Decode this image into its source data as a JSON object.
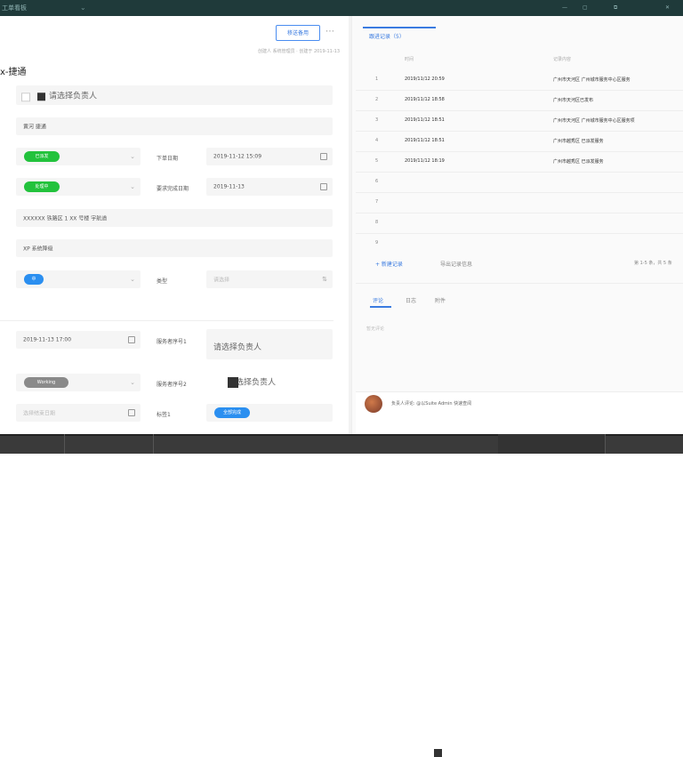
{
  "window": {
    "title": "工单看板"
  },
  "header": {
    "action_button": "移送备用",
    "meta": "创建人 系统管理员 · 创建于 2019-11-13",
    "page_title": "x-捷通"
  },
  "form": {
    "name_placeholder": "请选择负责人",
    "customer_value": "黄河 捷通",
    "status1_tag": "已派发",
    "status2_tag": "处理中",
    "order_date_label": "下单日期",
    "order_date_value": "2019-11-12 15:09",
    "deadline_label": "要求完成日期",
    "deadline_value": "2019-11-13",
    "address": "XXXXXX 铁路区 1 XX 号楼 宇航道",
    "remark": "XP 系统降级",
    "priority_tag": "中",
    "type_label": "类型",
    "type_placeholder": "请选择",
    "time2_value": "2019-11-13 17:00",
    "service_label": "服务者序号1",
    "service_placeholder": "请选择负责人",
    "status3_tag": "Working",
    "service2_label": "服务者序号2",
    "service2_value": "请选择负责人",
    "date3_placeholder": "选择结束日期",
    "level_label": "标签1",
    "level_tag": "全部完成"
  },
  "records": {
    "tab_label": "跟进记录（5）",
    "col_time": "时间",
    "col_content": "记录内容",
    "rows": [
      {
        "n": "1",
        "time": "2019/11/12 20:59",
        "content": "广州市天河区 广州城市服务中心区服务"
      },
      {
        "n": "2",
        "time": "2019/11/12 18:58",
        "content": "广州市天河区已发布"
      },
      {
        "n": "3",
        "time": "2019/11/12 18:51",
        "content": "广州市天河区 广州城市服务中心区服务项"
      },
      {
        "n": "4",
        "time": "2019/11/12 18:51",
        "content": "广州市越秀区 已派发服务"
      },
      {
        "n": "5",
        "time": "2019/11/12 18:19",
        "content": "广州市越秀区 已派发服务"
      }
    ],
    "empty_rows": [
      "6",
      "7",
      "8",
      "9"
    ],
    "add_link": "+ 新建记录",
    "export_link": "导出记录信息",
    "page_info": "第 1-5 条，共 5 条"
  },
  "activity": {
    "tabs": [
      "评论",
      "日志",
      "附件"
    ],
    "note": "暂无评论",
    "comment": "负责人评论: @以Suite Admin 快速查阅"
  },
  "colors": {
    "topbar": "#1f3a3a",
    "accent": "#3a7be0",
    "green_tag": "#22c23c",
    "blue_tag": "#2b8ff0",
    "gray_tag": "#8a8a8a"
  }
}
